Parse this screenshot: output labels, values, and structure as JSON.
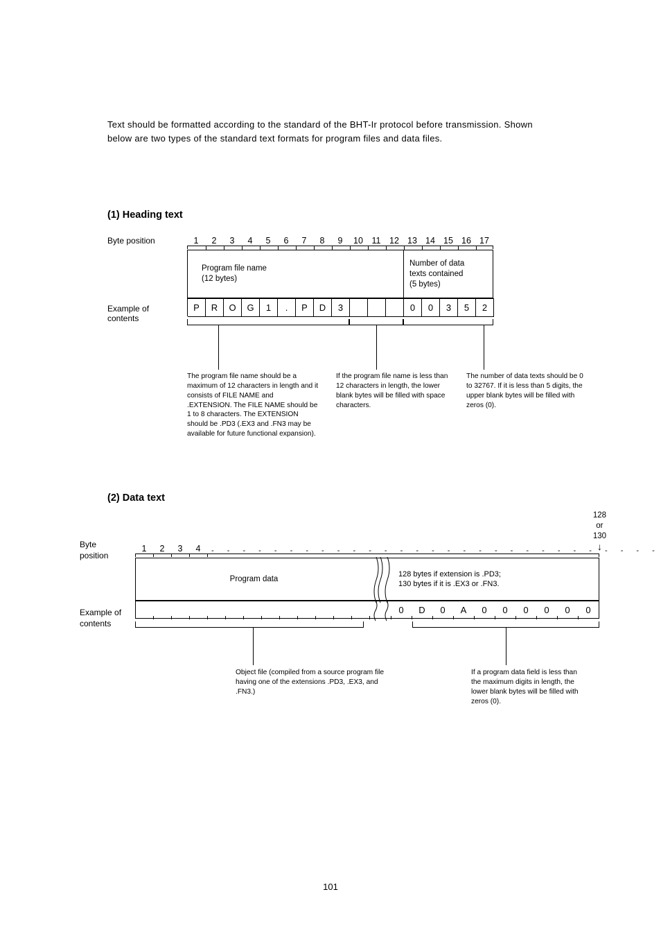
{
  "intro": "Text should be formatted according to the standard of the BHT-Ir protocol before transmission.  Shown below are two types of the standard text formats for program files and data files.",
  "section1": {
    "heading": "(1)  Heading text",
    "byteLabel": "Byte position",
    "exampleLabel1": "Example of",
    "exampleLabel2": "contents",
    "nums": [
      "1",
      "2",
      "3",
      "4",
      "5",
      "6",
      "7",
      "8",
      "9",
      "10",
      "11",
      "12",
      "13",
      "14",
      "15",
      "16",
      "17"
    ],
    "box1_line1": "Program file name",
    "box1_line2": "(12 bytes)",
    "box2_line1": "Number of data",
    "box2_line2": "texts contained",
    "box2_line3": "(5 bytes)",
    "cells": [
      "P",
      "R",
      "O",
      "G",
      "1",
      ".",
      "P",
      "D",
      "3",
      "",
      "",
      "",
      "0",
      "0",
      "3",
      "5",
      "2"
    ],
    "annotA": "The program file name should be a maximum of 12 characters in length and it consists of FILE NAME and .EXTENSION.  The FILE NAME should be 1 to 8 characters.  The EXTENSION should be .PD3 (.EX3 and .FN3 may be available for future functional expansion).",
    "annotB": "If the program file name is less than 12 characters in length, the lower blank bytes will be filled with space characters.",
    "annotC": "The number of data texts should be 0 to 32767.  If it is less than 5 digits, the upper blank bytes will be filled with zeros (0)."
  },
  "section2": {
    "heading": "(2)  Data text",
    "toplabel1": "128",
    "toplabel2": "or",
    "toplabel3": "130",
    "byteLabel1": "Byte",
    "byteLabel2": "position",
    "exampleLabel1": "Example of",
    "exampleLabel2": "contents",
    "nums": [
      "1",
      "2",
      "3",
      "4"
    ],
    "box1": "Program data",
    "box2_line1": "128 bytes if extension is .PD3;",
    "box2_line2": "130 bytes if it is .EX3 or .FN3.",
    "rcells": [
      "0",
      "D",
      "0",
      "A",
      "0",
      "0",
      "0",
      "0",
      "0",
      "0"
    ],
    "annotA": "Object file (compiled from a source program file having one of the extensions .PD3, .EX3, and .FN3.)",
    "annotB": "If a program data field is less than the maximum digits in length, the lower blank bytes will be filled with zeros (0)."
  },
  "pageNum": "101"
}
